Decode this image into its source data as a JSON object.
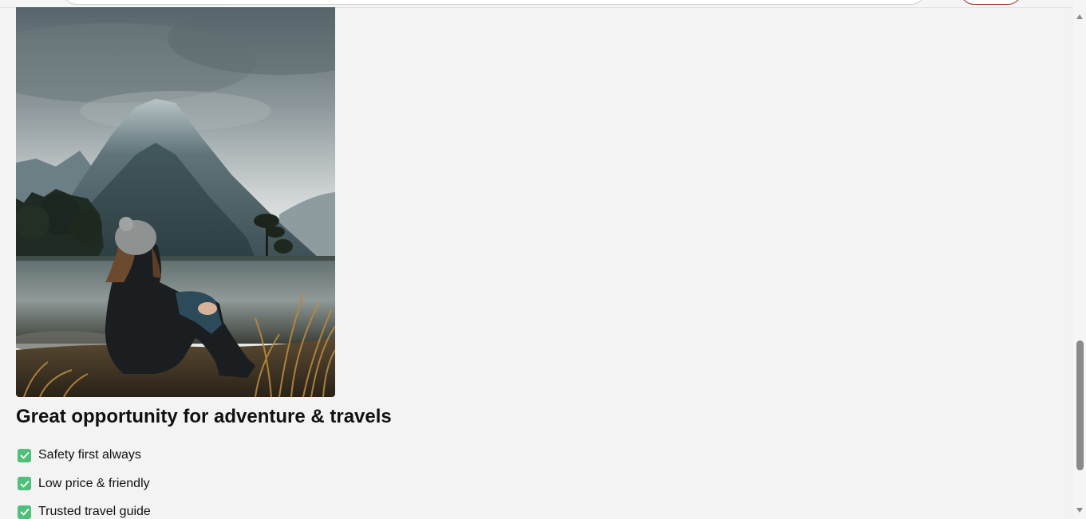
{
  "section": {
    "title": "Great opportunity for adventure & travels",
    "features": [
      {
        "label": "Safety first always",
        "icon": "check-box-icon"
      },
      {
        "label": "Low price & friendly",
        "icon": "check-box-icon"
      },
      {
        "label": "Trusted travel guide",
        "icon": "check-box-icon"
      }
    ]
  },
  "colors": {
    "background": "#f3f3f3",
    "check_green": "#4fbf7a",
    "title_text": "#111111",
    "header_button_border": "#a0302a"
  },
  "scrollbar": {
    "position_fraction": 0.8
  }
}
